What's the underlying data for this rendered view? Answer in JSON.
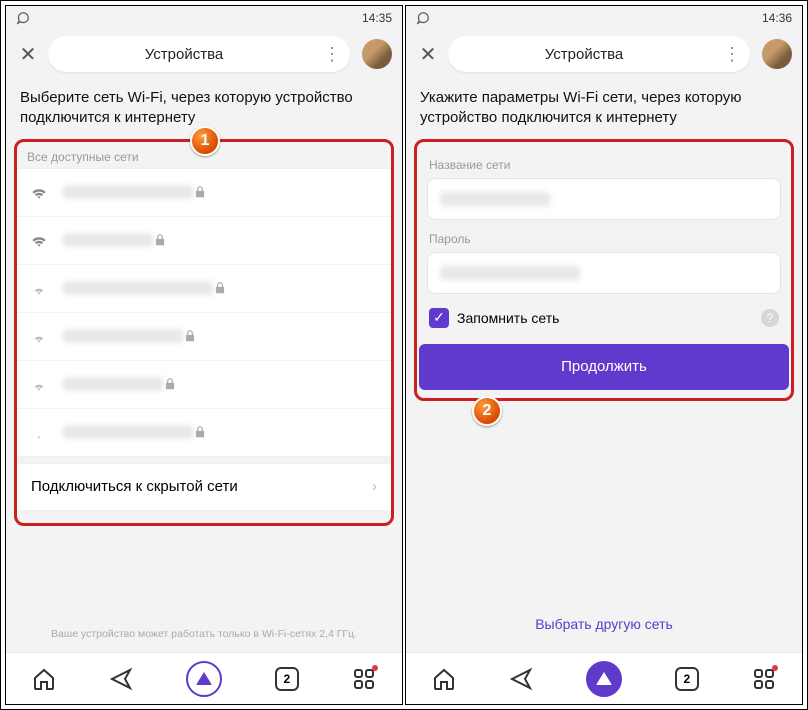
{
  "left": {
    "time": "14:35",
    "title": "Устройства",
    "heading": "Выберите сеть Wi-Fi, через которую устройство подключится к интернету",
    "section_label": "Все доступные сети",
    "wifi_items": [
      {
        "strength": 3
      },
      {
        "strength": 3
      },
      {
        "strength": 2
      },
      {
        "strength": 2
      },
      {
        "strength": 2
      },
      {
        "strength": 1
      }
    ],
    "hidden_label": "Подключиться к скрытой сети",
    "footnote": "Ваше устройство может работать только в Wi-Fi-сетях 2,4 ГГц.",
    "badge": "1"
  },
  "right": {
    "time": "14:36",
    "title": "Устройства",
    "heading": "Укажите параметры Wi-Fi сети, через которую устройство подключится к интернету",
    "name_label": "Название сети",
    "password_label": "Пароль",
    "remember_label": "Запомнить сеть",
    "continue_label": "Продолжить",
    "other_label": "Выбрать другую сеть",
    "badge": "2"
  },
  "nav": {
    "tab_count": "2"
  }
}
